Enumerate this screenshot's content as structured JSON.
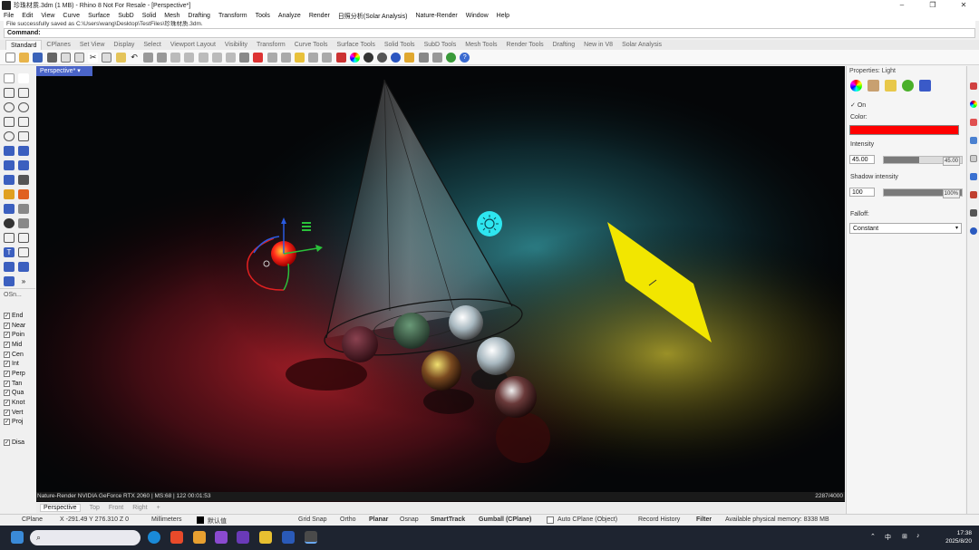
{
  "window": {
    "title": "珍珠材质.3dm (1 MB) - Rhino 8 Not For Resale - [Perspective*]",
    "buttons": [
      "–",
      "❐",
      "✕"
    ]
  },
  "menu": [
    "File",
    "Edit",
    "View",
    "Curve",
    "Surface",
    "SubD",
    "Solid",
    "Mesh",
    "Drafting",
    "Transform",
    "Tools",
    "Analyze",
    "Render",
    "日照分析(Solar Analysis)",
    "Nature-Render",
    "Window",
    "Help"
  ],
  "command": {
    "history": "File successfully saved as C:\\Users\\wang\\Desktop\\TestFiles\\珍珠材质.3dm.",
    "label": "Command:",
    "value": ""
  },
  "toolbar_tabs": [
    "Standard",
    "CPlanes",
    "Set View",
    "Display",
    "Select",
    "Viewport Layout",
    "Visibility",
    "Transform",
    "Curve Tools",
    "Surface Tools",
    "Solid Tools",
    "SubD Tools",
    "Mesh Tools",
    "Render Tools",
    "Drafting",
    "New in V8",
    "Solar Analysis"
  ],
  "viewport": {
    "tab_label": "Perspective*",
    "status_left": "Nature-Render    NVIDIA GeForce RTX 2060 | MS:68 | 122    00:01:53",
    "status_right": "2287/4000"
  },
  "view_tabs": [
    "Perspective",
    "Top",
    "Front",
    "Right",
    "+"
  ],
  "osnap": {
    "header": "OSn...",
    "items": [
      {
        "label": "End",
        "checked": true
      },
      {
        "label": "Near",
        "checked": true
      },
      {
        "label": "Poin",
        "checked": true
      },
      {
        "label": "Mid",
        "checked": true
      },
      {
        "label": "Cen",
        "checked": true
      },
      {
        "label": "Int",
        "checked": true
      },
      {
        "label": "Perp",
        "checked": true
      },
      {
        "label": "Tan",
        "checked": true
      },
      {
        "label": "Qua",
        "checked": true
      },
      {
        "label": "Knot",
        "checked": true
      },
      {
        "label": "Vert",
        "checked": true
      },
      {
        "label": "Proj",
        "checked": true
      }
    ],
    "disable_label": "Disa"
  },
  "properties": {
    "header": "Properties: Light",
    "on_label": "On",
    "color_label": "Color:",
    "color_value": "#ff0000",
    "intensity_label": "Intensity",
    "intensity_value": "45.00",
    "intensity_slider_text": "45.00",
    "intensity_fraction": 0.45,
    "shadow_label": "Shadow intensity",
    "shadow_value": "100",
    "shadow_slider_text": "100%",
    "shadow_fraction": 1.0,
    "falloff_label": "Falloff:",
    "falloff_value": "Constant"
  },
  "statusbar": {
    "cplane": "CPlane",
    "coords": "X -291.49  Y 276.310  Z 0",
    "units": "Millimeters",
    "layer": "默认值",
    "grid_snap": "Grid Snap",
    "ortho": "Ortho",
    "planar": "Planar",
    "osnap": "Osnap",
    "smarttrack": "SmartTrack",
    "gumball": "Gumball (CPlane)",
    "auto_cplane": "Auto CPlane (Object)",
    "record_history": "Record History",
    "filter": "Filter",
    "memory": "Available physical memory: 8338 MB"
  },
  "taskbar": {
    "search_text": "",
    "tray_lang": "中",
    "time": "17:38",
    "date": "2025/8/20"
  },
  "colors": {
    "accent": "#4a64c8",
    "light_color": "#ff0000",
    "yellow_light": "#f2e600",
    "cyan_light": "#2ee6f0"
  }
}
